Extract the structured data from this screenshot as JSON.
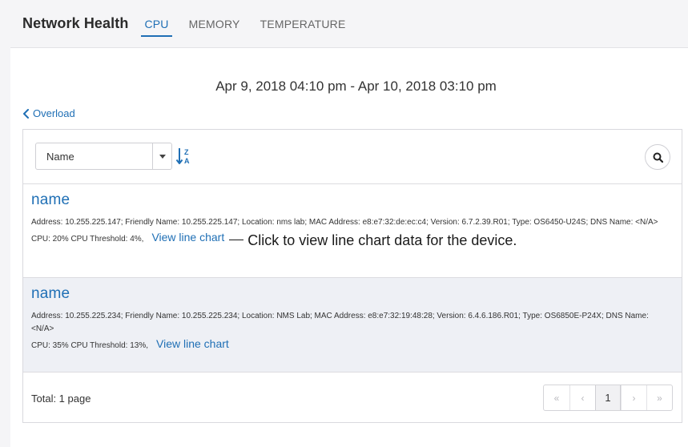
{
  "header": {
    "title": "Network Health",
    "tabs": [
      {
        "label": "CPU",
        "active": true
      },
      {
        "label": "MEMORY",
        "active": false
      },
      {
        "label": "TEMPERATURE",
        "active": false
      }
    ]
  },
  "date_range": "Apr 9, 2018 04:10 pm - Apr 10, 2018 03:10 pm",
  "back_link": {
    "label": "Overload",
    "icon": "chevron-left-icon"
  },
  "toolbar": {
    "sort_field": "Name",
    "sort_icon": "sort-z-a-icon",
    "search_icon": "search-icon"
  },
  "devices": [
    {
      "name": "name",
      "details": "Address: 10.255.225.147; Friendly Name: 10.255.225.147; Location: nms lab; MAC Address: e8:e7:32:de:ec:c4; Version: 6.7.2.39.R01; Type: OS6450-U24S; DNS Name: <N/A>",
      "cpu": "CPU: 20% CPU Threshold: 4%,",
      "chart_link": "View line chart",
      "callout": "Click to view line chart data for the device."
    },
    {
      "name": "name",
      "details": "Address: 10.255.225.234; Friendly Name: 10.255.225.234; Location: NMS Lab; MAC Address: e8:e7:32:19:48:28; Version: 6.4.6.186.R01; Type: OS6850E-P24X; DNS Name: <N/A>",
      "cpu": "CPU: 35% CPU Threshold: 13%,",
      "chart_link": "View line chart"
    }
  ],
  "footer": {
    "total": "Total: 1 page",
    "pager": {
      "first": "«",
      "prev": "‹",
      "current": "1",
      "next": "›",
      "last": "»"
    }
  },
  "colors": {
    "accent": "#1f6fb5",
    "header_bg": "#f5f5f7",
    "alt_row_bg": "#eef0f5"
  }
}
